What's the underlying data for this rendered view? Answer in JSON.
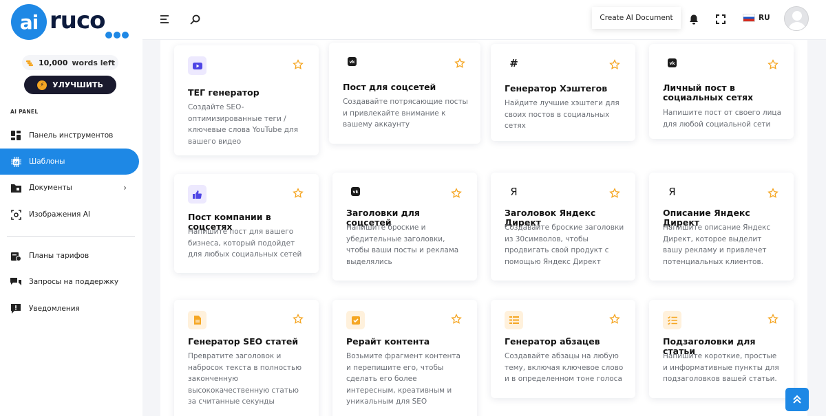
{
  "logo": {
    "circle_text": "ai",
    "text": "ruco"
  },
  "sidebar": {
    "words_count": "10,000",
    "words_suffix": "words left",
    "upgrade_label": "УЛУЧШИТЬ",
    "section_label": "AI PANEL",
    "items": [
      {
        "label": "Панель инструментов",
        "icon": "dashboard-icon"
      },
      {
        "label": "Шаблоны",
        "icon": "ai-chip-icon",
        "active": true
      },
      {
        "label": "Документы",
        "icon": "folder-icon",
        "has_chevron": true
      },
      {
        "label": "Изображения AI",
        "icon": "image-scan-icon"
      },
      {
        "label": "Планы тарифов",
        "icon": "plans-icon"
      },
      {
        "label": "Запросы на поддержку",
        "icon": "support-chat-icon"
      },
      {
        "label": "Уведомления",
        "icon": "notification-chat-icon"
      }
    ]
  },
  "topbar": {
    "create_document_label": "Create AI Document",
    "language": "RU"
  },
  "colors": {
    "accent": "#1e88e5",
    "star": "#f5a623",
    "dark": "#1a1a2e"
  },
  "cards": [
    {
      "title": "ТЕГ генератор",
      "desc": "Создайте SEO-оптимизированные теги / ключевые слова YouTube для вашего видео",
      "icon": "youtube-icon"
    },
    {
      "title": "Пост для соцсетей",
      "desc": "Создавайте потрясающие посты и привлекайте внимание к вашему аккаунту",
      "icon": "vk-icon"
    },
    {
      "title": "Генератор Хэштегов",
      "desc": "Найдите лучшие хэштеги для своих постов в социальных сетях",
      "icon": "hashtag-icon",
      "glyph": "#"
    },
    {
      "title": "Личный пост в социальных сетях",
      "desc": "Напишите пост от своего лица для любой социальной сети",
      "icon": "vk-icon"
    },
    {
      "title": "Пост компании в соцсетях",
      "desc": "Напишите пост для вашего бизнеса, который подойдет для любых социальных сетей",
      "icon": "thumbs-up-icon"
    },
    {
      "title": "Заголовки для соцсетей",
      "desc": "Напишите броские и убедительные заголовки, чтобы ваши посты и реклама выделялись",
      "icon": "vk-icon"
    },
    {
      "title": "Заголовок Яндекс Директ",
      "desc": "Создавайте броские заголовки из 30символов, чтобы продвигать свой продукт с помощью Яндекс Директ",
      "icon": "yandex-icon",
      "glyph": "Я"
    },
    {
      "title": "Описание Яндекс Директ",
      "desc": "Напишите описание Яндекс Директ, которое выделит вашу рекламу и привлечет потенциальных клиентов.",
      "icon": "yandex-icon",
      "glyph": "Я"
    },
    {
      "title": "Генератор SEO статей",
      "desc": "Превратите заголовок и набросок текста в полностью законченную высококачественную статью за считанные секунды",
      "icon": "document-icon"
    },
    {
      "title": "Рерайт контента",
      "desc": "Возьмите фрагмент контента и перепишите его, чтобы сделать его более интересным, креативным и уникальным для SEO",
      "icon": "checkbox-icon"
    },
    {
      "title": "Генератор абзацев",
      "desc": "Создавайте абзацы на любую тему, включая ключевое слово и в определенном тоне голоса",
      "icon": "paragraph-icon"
    },
    {
      "title": "Подзаголовки для статьи",
      "desc": "Напишите короткие, простые и информативные пункты для подзаголовков вашей статьи.",
      "icon": "checklist-icon"
    }
  ]
}
